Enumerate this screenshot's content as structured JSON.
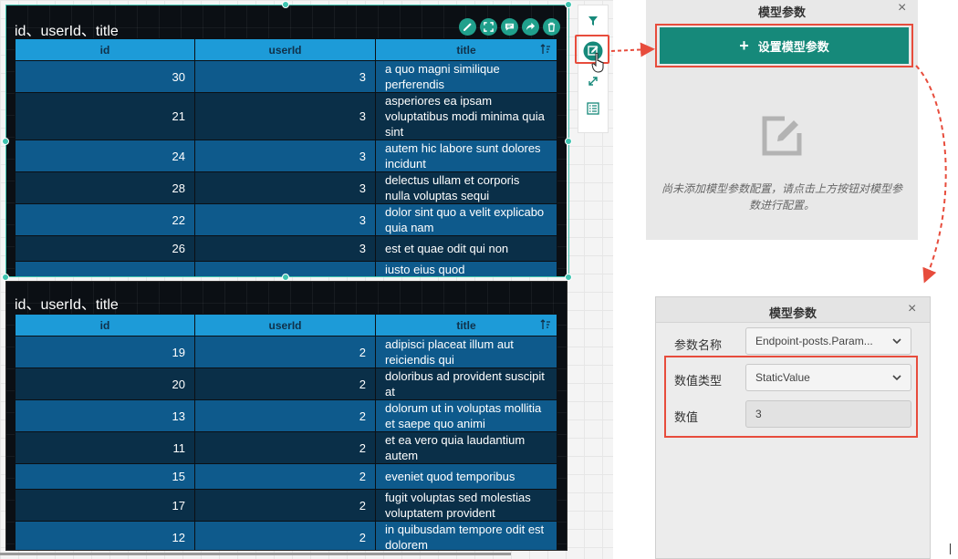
{
  "widgets": [
    {
      "title": "id、userId、title",
      "columns": [
        "id",
        "userId",
        "title"
      ],
      "rows": [
        {
          "id": "30",
          "userId": "3",
          "title": "a quo magni similique perferendis"
        },
        {
          "id": "21",
          "userId": "3",
          "title": "asperiores ea ipsam voluptatibus modi minima quia sint"
        },
        {
          "id": "24",
          "userId": "3",
          "title": "autem hic labore sunt dolores incidunt"
        },
        {
          "id": "28",
          "userId": "3",
          "title": "delectus ullam et corporis nulla voluptas sequi"
        },
        {
          "id": "22",
          "userId": "3",
          "title": "dolor sint quo a velit explicabo quia nam"
        },
        {
          "id": "26",
          "userId": "3",
          "title": "est et quae odit qui non"
        },
        {
          "id": "",
          "userId": "",
          "title": "iusto eius quod"
        }
      ]
    },
    {
      "title": "id、userId、title",
      "columns": [
        "id",
        "userId",
        "title"
      ],
      "rows": [
        {
          "id": "19",
          "userId": "2",
          "title": "adipisci placeat illum aut reiciendis qui"
        },
        {
          "id": "20",
          "userId": "2",
          "title": "doloribus ad provident suscipit at"
        },
        {
          "id": "13",
          "userId": "2",
          "title": "dolorum ut in voluptas mollitia et saepe quo animi"
        },
        {
          "id": "11",
          "userId": "2",
          "title": "et ea vero quia laudantium autem"
        },
        {
          "id": "15",
          "userId": "2",
          "title": "eveniet quod temporibus"
        },
        {
          "id": "17",
          "userId": "2",
          "title": "fugit voluptas sed molestias voluptatem provident"
        },
        {
          "id": "12",
          "userId": "2",
          "title": "in quibusdam tempore odit est dolorem"
        }
      ]
    }
  ],
  "widget_toolbar_icons": [
    "pencil-icon",
    "expand-icon",
    "comment-icon",
    "share-icon",
    "trash-icon"
  ],
  "vertical_toolbar_icons": [
    "filter-icon",
    "edit-params-icon",
    "resize-icon",
    "list-icon"
  ],
  "panel1": {
    "title": "模型参数",
    "close": "×",
    "button_label": "设置模型参数",
    "button_icon": "+",
    "empty_text": "尚未添加模型参数配置，请点击上方按钮对模型参数进行配置。"
  },
  "panel2": {
    "title": "模型参数",
    "close": "×",
    "fields": [
      {
        "label": "参数名称",
        "value": "Endpoint-posts.Param..."
      },
      {
        "label": "数值类型",
        "value": "StaticValue"
      },
      {
        "label": "数值",
        "value": "3"
      }
    ]
  },
  "colors": {
    "accent": "#16897a",
    "highlight": "#e74c3c",
    "header": "#1d9bd8",
    "row_odd": "#0e5a8c",
    "row_even": "#0a2f48"
  }
}
